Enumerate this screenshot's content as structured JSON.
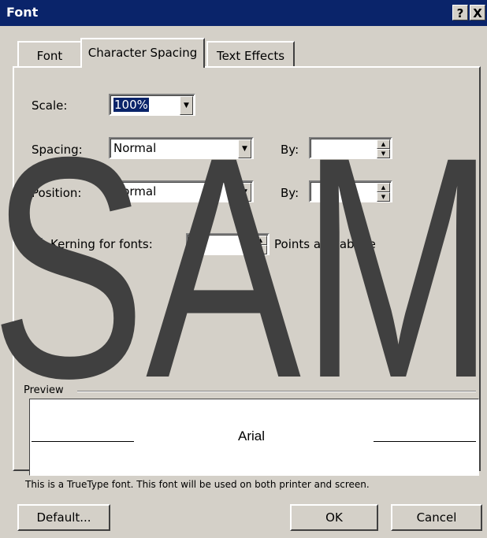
{
  "window": {
    "title": "Font",
    "help_button": "?",
    "close_button": "X"
  },
  "tabs": [
    {
      "label": "Font",
      "active": false
    },
    {
      "label": "Character Spacing",
      "active": true
    },
    {
      "label": "Text Effects",
      "active": false
    }
  ],
  "fields": {
    "scale": {
      "label": "Scale:",
      "value": "100%"
    },
    "spacing": {
      "label": "Spacing:",
      "value": "Normal",
      "by_label": "By:",
      "by_value": ""
    },
    "position": {
      "label": "Position:",
      "value": "Normal",
      "by_label": "By:",
      "by_value": ""
    },
    "kerning": {
      "label": "Kerning for fonts:",
      "checked": false,
      "value": "",
      "suffix": "Points and above"
    }
  },
  "preview": {
    "label": "Preview",
    "sample_text": "Arial",
    "description": "This is a TrueType font. This font will be used on both printer and screen."
  },
  "buttons": {
    "default": "Default...",
    "ok": "OK",
    "cancel": "Cancel"
  },
  "watermark": {
    "text": "SAM",
    "color": "#404040"
  },
  "colors": {
    "face": "#d4d0c8",
    "titlebar": "#0a246a",
    "selection": "#0a246a"
  }
}
